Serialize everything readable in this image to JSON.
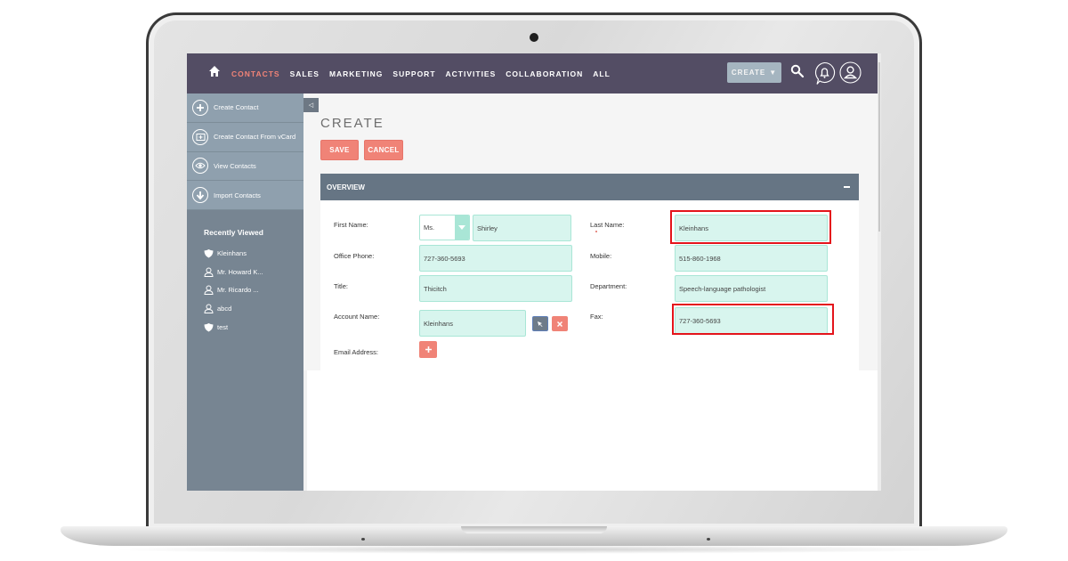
{
  "nav": {
    "home_icon": "home-icon",
    "items": [
      {
        "label": "CONTACTS",
        "active": true
      },
      {
        "label": "SALES",
        "active": false
      },
      {
        "label": "MARKETING",
        "active": false
      },
      {
        "label": "SUPPORT",
        "active": false
      },
      {
        "label": "ACTIVITIES",
        "active": false
      },
      {
        "label": "COLLABORATION",
        "active": false
      },
      {
        "label": "ALL",
        "active": false
      }
    ],
    "create_label": "CREATE",
    "create_caret": "▼",
    "icons": [
      "search-icon",
      "bell-icon",
      "user-icon"
    ]
  },
  "sidebar": {
    "actions": [
      {
        "label": "Create Contact",
        "icon": "plus-circle-icon"
      },
      {
        "label": "Create Contact From vCard",
        "icon": "vcard-icon"
      },
      {
        "label": "View Contacts",
        "icon": "eye-icon"
      },
      {
        "label": "Import Contacts",
        "icon": "download-icon"
      }
    ],
    "recent_title": "Recently Viewed",
    "recent": [
      {
        "label": "Kleinhans",
        "icon": "shield-icon"
      },
      {
        "label": "Mr. Howard K...",
        "icon": "person-icon"
      },
      {
        "label": "Mr. Ricardo ...",
        "icon": "person-icon"
      },
      {
        "label": "abcd",
        "icon": "person-icon"
      },
      {
        "label": "test",
        "icon": "shield-icon"
      }
    ]
  },
  "main": {
    "collapse_glyph": "◁",
    "title": "CREATE",
    "save_label": "SAVE",
    "cancel_label": "CANCEL",
    "panel": {
      "title": "OVERVIEW",
      "fields": {
        "first_name": {
          "label": "First Name:",
          "salutation": "Ms.",
          "value": "Shirley"
        },
        "last_name": {
          "label": "Last Name:",
          "value": "Kleinhans",
          "required": true,
          "highlighted": true
        },
        "office_phone": {
          "label": "Office Phone:",
          "value": "727-360-5693"
        },
        "mobile": {
          "label": "Mobile:",
          "value": "515-860-1968"
        },
        "title": {
          "label": "Title:",
          "value": "Thicitch"
        },
        "department": {
          "label": "Department:",
          "value": "Speech-language pathologist"
        },
        "account_name": {
          "label": "Account Name:",
          "value": "Kleinhans"
        },
        "fax": {
          "label": "Fax:",
          "value": "727-360-5693",
          "highlighted": true
        },
        "email_address": {
          "label": "Email Address:"
        }
      }
    }
  },
  "colors": {
    "nav_bg": "#534d64",
    "active_nav": "#f08377",
    "button": "#f08377",
    "panel_header": "#667584",
    "input_bg": "#d8f5ee",
    "highlight": "#e4141b",
    "sidebar_actions": "#8fa0ae",
    "sidebar_bg": "#778592"
  }
}
